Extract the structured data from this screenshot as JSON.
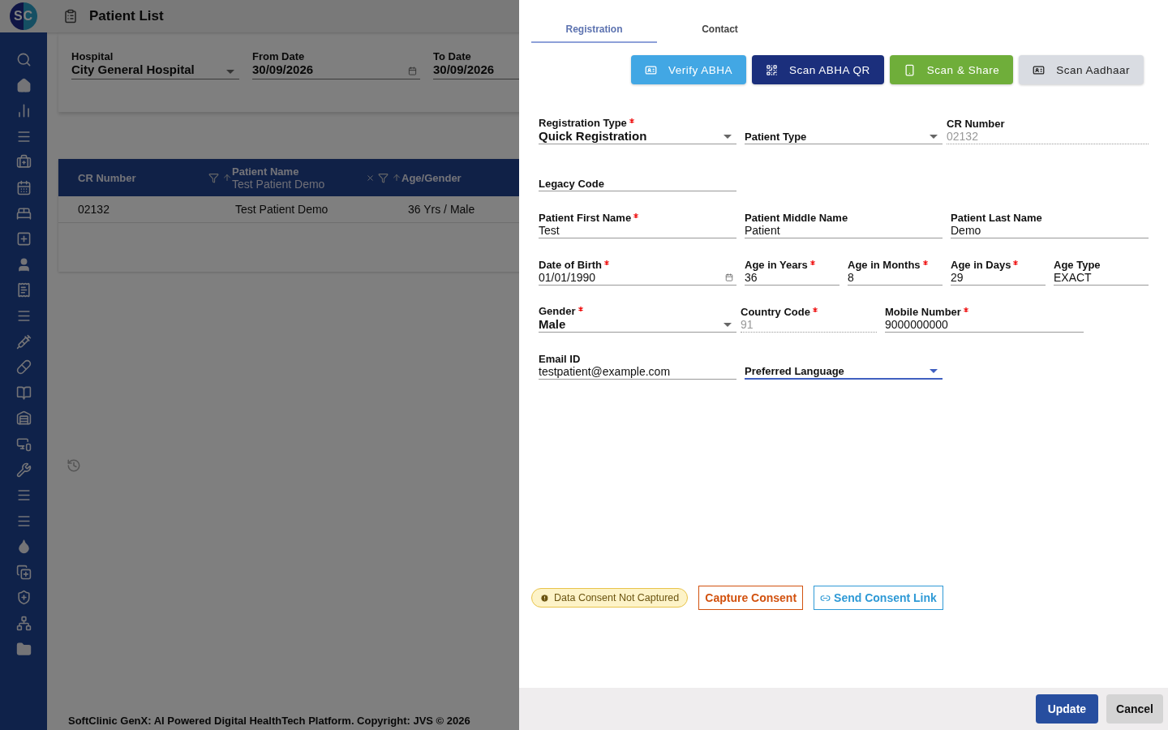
{
  "app": {
    "logo": "SC",
    "title": "Patient List"
  },
  "filters": [
    {
      "label": "Hospital",
      "value": "City General Hospital",
      "kind": "select"
    },
    {
      "label": "From Date",
      "value": "30/09/2026",
      "kind": "date"
    },
    {
      "label": "To Date",
      "value": "30/09/2026",
      "kind": "date"
    }
  ],
  "table": {
    "columns": [
      {
        "label": "CR Number"
      },
      {
        "label": "Patient Name",
        "filter_value": "Test Patient Demo"
      },
      {
        "label": "Age/Gender"
      }
    ],
    "rows": [
      [
        "02132",
        "Test Patient Demo",
        "36 Yrs / Male"
      ]
    ]
  },
  "footer": "SoftClinic GenX: AI Powered Digital HealthTech Platform. Copyright: JVS © 2026",
  "drawer": {
    "tabs": [
      {
        "label": "Registration",
        "selected": true
      },
      {
        "label": "Contact",
        "selected": false
      }
    ],
    "actions": [
      {
        "label": "Verify ABHA",
        "kind": "verify"
      },
      {
        "label": "Scan ABHA QR",
        "kind": "qr"
      },
      {
        "label": "Scan & Share",
        "kind": "share"
      },
      {
        "label": "Scan Aadhaar",
        "kind": "aadhaar"
      }
    ],
    "rows": [
      {
        "kind": "thirds",
        "fields": [
          {
            "label": "Registration Type",
            "required": true,
            "value": "Quick Registration",
            "kind": "select",
            "focused": false
          },
          {
            "label": "Patient Type",
            "required": false,
            "kind": "select",
            "focused": false
          },
          {
            "label": "CR Number",
            "required": false,
            "value": "02132",
            "kind": "readonly",
            "focused": false
          }
        ]
      },
      {
        "kind": "thirds",
        "fields": [
          {
            "label": "Legacy Code",
            "required": false,
            "kind": "text",
            "focused": false
          }
        ]
      },
      {
        "kind": "thirds",
        "fields": [
          {
            "label": "Patient First Name",
            "required": true,
            "value": "Test",
            "kind": "text",
            "focused": false
          },
          {
            "label": "Patient Middle Name",
            "required": false,
            "value": "Patient",
            "kind": "text",
            "focused": false
          },
          {
            "label": "Patient Last Name",
            "required": false,
            "value": "Demo",
            "kind": "text",
            "focused": false
          }
        ]
      },
      {
        "kind": "dob",
        "fields": [
          {
            "label": "Date of Birth",
            "required": true,
            "value": "01/01/1990",
            "kind": "date",
            "focused": false
          },
          {
            "label": "Age in Years",
            "required": true,
            "value": "36",
            "kind": "text",
            "focused": false
          },
          {
            "label": "Age in Months",
            "required": true,
            "value": "8",
            "kind": "text",
            "focused": false
          },
          {
            "label": "Age in Days",
            "required": true,
            "value": "29",
            "kind": "text",
            "focused": false
          },
          {
            "label": "Age Type",
            "required": false,
            "value": "EXACT",
            "kind": "text",
            "focused": false
          }
        ]
      },
      {
        "kind": "phone",
        "fields": [
          {
            "label": "Gender",
            "required": true,
            "value": "Male",
            "kind": "select",
            "focused": false
          },
          {
            "label": "Country Code",
            "required": true,
            "value": "91",
            "kind": "readonly",
            "focused": false
          },
          {
            "label": "Mobile Number",
            "required": true,
            "value": "9000000000",
            "kind": "text",
            "focused": false
          }
        ]
      },
      {
        "kind": "thirds",
        "fields": [
          {
            "label": "Email ID",
            "required": false,
            "value": "testpatient@example.com",
            "kind": "text",
            "focused": false
          },
          {
            "label": "Preferred Language",
            "required": false,
            "kind": "select",
            "focused": true
          }
        ]
      }
    ],
    "consent": {
      "status": "Data Consent Not Captured",
      "capture": "Capture Consent",
      "send": "Send Consent Link"
    },
    "buttons": [
      {
        "label": "Update",
        "kind": "primary"
      },
      {
        "label": "Cancel",
        "kind": "secondary"
      }
    ]
  }
}
